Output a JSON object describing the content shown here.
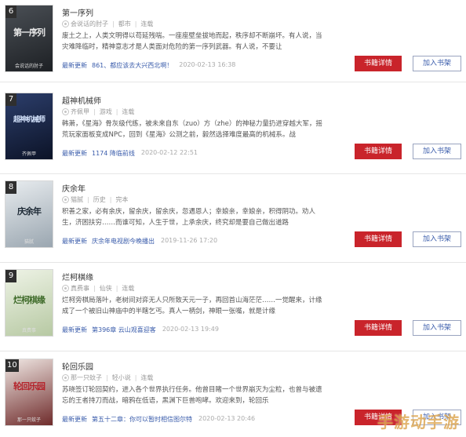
{
  "buttons": {
    "detail": "书籍详情",
    "shelf": "加入书架"
  },
  "latest_label": "最新更新",
  "watermark": "手游动手游",
  "books": [
    {
      "rank": "6",
      "title": "第一序列",
      "author": "会说话的肘子",
      "category": "都市",
      "status": "连载",
      "desc": "废土之上，人类文明得以苟延残喘。一座座壁垒拔地而起，秩序却不断崩坏。有人说，当灾难降临时，精神意志才是人类面对危险的第一序列武器。有人说，不要让",
      "latest_chapter": "861、都应该去大兴西北啊！",
      "time": "2020-02-13 16:38",
      "cover": {
        "text": "第一序列",
        "author": "会说话的肘子",
        "bg1": "#4a4f55",
        "bg2": "#1d2024",
        "color": "#e9e9e9"
      }
    },
    {
      "rank": "7",
      "title": "超神机械师",
      "author": "齐佩甲",
      "category": "游戏",
      "status": "连载",
      "desc": "韩萧，《星海》骨灰级代练，被未来自东（zuo）方（zhe）的神秘力量扔进穿越大军，摇荒玩家面板变成NPC，回到《星海》公测之前，毅然选择难度最高的机械系。战",
      "latest_chapter": "1174 降临前线",
      "time": "2020-02-12 22:51",
      "cover": {
        "text": "超神机械师",
        "author": "齐佩甲",
        "bg1": "#2c3e6b",
        "bg2": "#0c1327",
        "color": "#d7e6ff"
      }
    },
    {
      "rank": "8",
      "title": "庆余年",
      "author": "猫腻",
      "category": "历史",
      "status": "完本",
      "desc": "积善之家，必有余庆，留余庆，留余庆，忽遇恩人；幸娘亲，幸娘亲，积得阴功。劝人生，济困扶穷……而谁可知，人生于世，上承余庆，终究却是要自己做出道路",
      "latest_chapter": "庆余年电视剧今晚播出",
      "time": "2019-11-26 17:20",
      "cover": {
        "text": "庆余年",
        "author": "猫腻",
        "bg1": "#e8ecef",
        "bg2": "#9aa6b0",
        "color": "#1e2a36"
      }
    },
    {
      "rank": "9",
      "title": "烂柯棋缘",
      "author": "真费事",
      "category": "仙侠",
      "status": "连载",
      "desc": "烂柯旁棋局落叶，老树间对弈无人只所致天元一子，再回首山海茫茫……一觉醒来，计缘成了一个被旧山神庙中的半瞎乞丐。真人一柄剑，神眼一张嘴，就是计缘",
      "latest_chapter": "第396章 云山观喜迎客",
      "time": "2020-02-13 19:49",
      "cover": {
        "text": "烂柯棋缘",
        "author": "真费事",
        "bg1": "#eef3e6",
        "bg2": "#b7c9a3",
        "color": "#3f6b2a"
      }
    },
    {
      "rank": "10",
      "title": "轮回乐园",
      "author": "那一只蚊子",
      "category": "轻小说",
      "status": "连载",
      "desc": "苏晓签订轮回契约，进入各个世界执行任务。他曾目睹一个世界崩灭为尘粒，也曾与被遗忘的王者持刀而战，暗鸦在低语，黑渊下巨兽咆哮。欢迎来到，轮回乐",
      "latest_chapter": "第五十二章：你可以暂时相信图尔特",
      "time": "2020-02-13 20:46",
      "cover": {
        "text": "轮回乐园",
        "author": "那一只蚊子",
        "bg1": "#f0e8e4",
        "bg2": "#6f2b2b",
        "color": "#b5222a"
      }
    }
  ]
}
